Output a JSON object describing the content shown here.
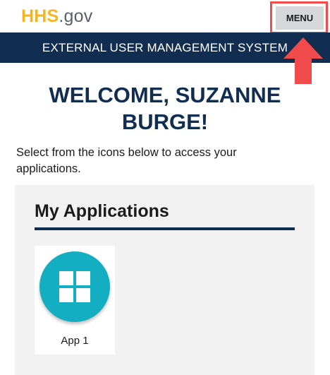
{
  "header": {
    "logo_primary": "HHS",
    "logo_secondary": ".gov",
    "menu_label": "MENU"
  },
  "banner": {
    "title": "EXTERNAL USER MANAGEMENT SYSTEM"
  },
  "welcome": {
    "heading": "WELCOME, SUZANNE BURGE!",
    "intro": "Select from the icons below to access your applications."
  },
  "applications": {
    "title": "My Applications",
    "items": [
      {
        "label": "App 1",
        "icon": "grid-icon"
      }
    ]
  },
  "annotation": {
    "highlight_color": "#f24b4b",
    "arrow_icon": "up-arrow-icon"
  },
  "colors": {
    "brand_navy": "#112e51",
    "logo_gold": "#f5b523",
    "app_teal": "#13aec1",
    "panel_bg": "#f1f1f1"
  }
}
